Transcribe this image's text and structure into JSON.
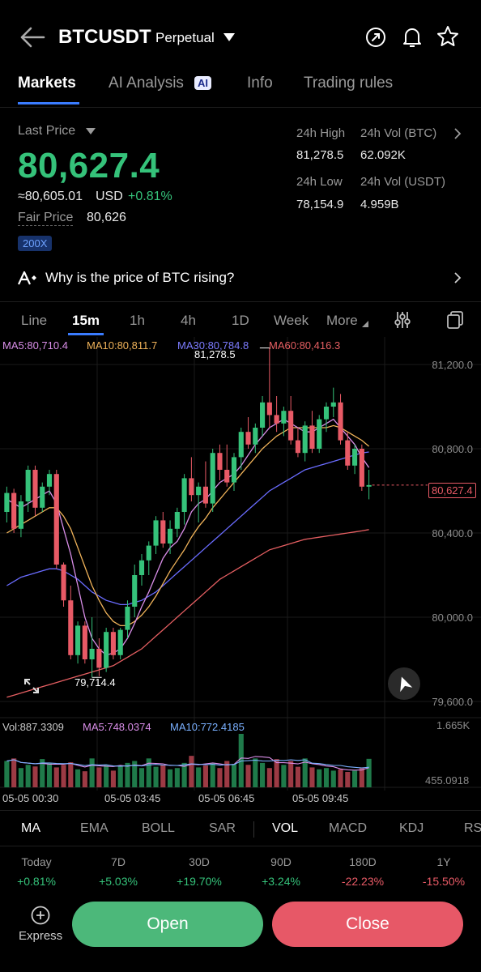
{
  "header": {
    "symbol": "BTCUSDT",
    "contract_type": "Perpetual",
    "icons": [
      "back-arrow-icon",
      "share-refresh-icon",
      "bell-icon",
      "star-icon"
    ]
  },
  "tabs": [
    {
      "label": "Markets",
      "active": true
    },
    {
      "label": "AI Analysis",
      "badge": "AI"
    },
    {
      "label": "Info"
    },
    {
      "label": "Trading rules"
    }
  ],
  "price": {
    "last_price_label": "Last Price",
    "last_price": "80,627.4",
    "approx_usd": "≈80,605.01",
    "usd_label": "USD",
    "change_pct": "+0.81%",
    "fair_price_label": "Fair Price",
    "fair_price": "80,626",
    "leverage_badge": "200X"
  },
  "stats": {
    "high_label": "24h High",
    "high": "81,278.5",
    "vol_btc_label": "24h Vol (BTC)",
    "vol_btc": "62.092K",
    "low_label": "24h Low",
    "low": "78,154.9",
    "vol_usdt_label": "24h Vol  (USDT)",
    "vol_usdt": "4.959B"
  },
  "insight": {
    "text": "Why is the price of BTC rising?"
  },
  "timeframes": [
    "Line",
    "15m",
    "1h",
    "4h",
    "1D",
    "Week",
    "More"
  ],
  "active_timeframe": "15m",
  "chart_data": {
    "type": "candlestick",
    "ma_legend": {
      "ma5": "MA5:80,710.4",
      "ma10": "MA10:80,811.7",
      "ma30": "MA30:80,784.8",
      "ma60": "MA60:80,416.3"
    },
    "y_ticks": [
      "81,200.0",
      "80,800.0",
      "80,400.0",
      "80,000.0",
      "79,600.0"
    ],
    "y_tick_values": [
      81200,
      80800,
      80400,
      80000,
      79600
    ],
    "high_marker": "81,278.5",
    "low_marker": "79,714.4",
    "current_price_tag": "80,627.4",
    "current_price": 80627.4,
    "x_ticks": [
      "05-05 00:30",
      "05-05 03:45",
      "05-05 06:45",
      "05-05 09:45"
    ],
    "candles": [
      [
        80500,
        80620,
        80450,
        80590
      ],
      [
        80590,
        80610,
        80400,
        80420
      ],
      [
        80420,
        80580,
        80380,
        80550
      ],
      [
        80550,
        80720,
        80500,
        80700
      ],
      [
        80700,
        80720,
        80480,
        80520
      ],
      [
        80520,
        80640,
        80500,
        80620
      ],
      [
        80620,
        80700,
        80580,
        80680
      ],
      [
        80680,
        80700,
        80230,
        80250
      ],
      [
        80250,
        80260,
        80050,
        80080
      ],
      [
        80080,
        80150,
        79800,
        79820
      ],
      [
        79820,
        79980,
        79780,
        79960
      ],
      [
        79960,
        79980,
        79780,
        79800
      ],
      [
        79800,
        80000,
        79714.4,
        79850
      ],
      [
        79850,
        79900,
        79720,
        79760
      ],
      [
        79760,
        79950,
        79740,
        79930
      ],
      [
        79930,
        79950,
        79800,
        79820
      ],
      [
        79820,
        79950,
        79800,
        79940
      ],
      [
        79940,
        80080,
        79900,
        80050
      ],
      [
        80050,
        80250,
        80000,
        80200
      ],
      [
        80200,
        80300,
        80150,
        80270
      ],
      [
        80270,
        80360,
        80200,
        80340
      ],
      [
        80340,
        80480,
        80300,
        80460
      ],
      [
        80460,
        80500,
        80330,
        80350
      ],
      [
        80350,
        80460,
        80300,
        80420
      ],
      [
        80420,
        80520,
        80380,
        80500
      ],
      [
        80500,
        80680,
        80440,
        80660
      ],
      [
        80660,
        80760,
        80550,
        80580
      ],
      [
        80580,
        80640,
        80450,
        80620
      ],
      [
        80620,
        80740,
        80520,
        80540
      ],
      [
        80540,
        80800,
        80500,
        80780
      ],
      [
        80780,
        80820,
        80650,
        80700
      ],
      [
        80700,
        80820,
        80620,
        80640
      ],
      [
        80640,
        80780,
        80600,
        80760
      ],
      [
        80760,
        80900,
        80700,
        80880
      ],
      [
        80880,
        80950,
        80800,
        80820
      ],
      [
        80820,
        80920,
        80780,
        80900
      ],
      [
        80900,
        81050,
        80860,
        81020
      ],
      [
        81020,
        81278.5,
        80900,
        80960
      ],
      [
        80960,
        81050,
        80880,
        80920
      ],
      [
        80920,
        81000,
        80860,
        80980
      ],
      [
        80980,
        81050,
        80820,
        80840
      ],
      [
        80840,
        80900,
        80760,
        80780
      ],
      [
        80780,
        80930,
        80740,
        80910
      ],
      [
        80910,
        80980,
        80780,
        80800
      ],
      [
        80800,
        80960,
        80780,
        80940
      ],
      [
        80940,
        81020,
        80880,
        81000
      ],
      [
        81000,
        81090,
        80950,
        81020
      ],
      [
        81020,
        81060,
        80820,
        80840
      ],
      [
        80840,
        80880,
        80700,
        80720
      ],
      [
        80720,
        80820,
        80680,
        80800
      ],
      [
        80800,
        80820,
        80600,
        80620
      ],
      [
        80620,
        80700,
        80560,
        80627.4
      ]
    ],
    "moving_averages": {
      "ma5": [
        80560,
        80540,
        80520,
        80540,
        80560,
        80580,
        80600,
        80540,
        80420,
        80300,
        80150,
        80000,
        79900,
        79850,
        79820,
        79830,
        79850,
        79900,
        79970,
        80050,
        80120,
        80200,
        80280,
        80330,
        80360,
        80420,
        80500,
        80540,
        80560,
        80600,
        80640,
        80660,
        80680,
        80720,
        80770,
        80820,
        80860,
        80900,
        80920,
        80940,
        80920,
        80900,
        80880,
        80880,
        80900,
        80920,
        80940,
        80900,
        80860,
        80820,
        80760,
        80710.4
      ],
      "ma10": [
        80400,
        80420,
        80440,
        80460,
        80480,
        80500,
        80520,
        80520,
        80480,
        80420,
        80330,
        80240,
        80150,
        80080,
        80020,
        79980,
        79960,
        79960,
        79980,
        80010,
        80050,
        80100,
        80160,
        80220,
        80270,
        80320,
        80380,
        80430,
        80470,
        80520,
        80560,
        80600,
        80640,
        80680,
        80720,
        80760,
        80800,
        80830,
        80860,
        80880,
        80900,
        80900,
        80900,
        80900,
        80900,
        80900,
        80910,
        80900,
        80880,
        80860,
        80840,
        80811.7
      ],
      "ma30": [
        80150,
        80170,
        80190,
        80200,
        80210,
        80220,
        80230,
        80230,
        80220,
        80200,
        80180,
        80150,
        80120,
        80100,
        80080,
        80070,
        80060,
        80060,
        80070,
        80080,
        80100,
        80120,
        80150,
        80180,
        80210,
        80240,
        80270,
        80300,
        80330,
        80360,
        80390,
        80420,
        80450,
        80480,
        80510,
        80540,
        80570,
        80600,
        80620,
        80640,
        80660,
        80680,
        80700,
        80710,
        80720,
        80730,
        80740,
        80750,
        80760,
        80770,
        80780,
        80784.8
      ],
      "ma60": [
        79620,
        79630,
        79640,
        79650,
        79660,
        79670,
        79680,
        79690,
        79700,
        79710,
        79720,
        79730,
        79740,
        79750,
        79760,
        79770,
        79790,
        79810,
        79830,
        79850,
        79880,
        79910,
        79940,
        79970,
        80000,
        80030,
        80060,
        80090,
        80120,
        80150,
        80180,
        80200,
        80220,
        80240,
        80260,
        80280,
        80300,
        80320,
        80330,
        80340,
        80350,
        80360,
        80370,
        80375,
        80380,
        80385,
        80390,
        80395,
        80400,
        80405,
        80410,
        80416.3
      ]
    },
    "volume": {
      "vol_label": "Vol:887.3309",
      "ma5_label": "MA5:748.0374",
      "ma10_label": "MA10:772.4185",
      "y_max": "1.665K",
      "y_min": "455.0918",
      "bars": [
        820,
        900,
        600,
        700,
        650,
        880,
        760,
        620,
        700,
        780,
        560,
        500,
        900,
        620,
        700,
        520,
        680,
        760,
        820,
        600,
        900,
        640,
        700,
        560,
        600,
        760,
        980,
        620,
        680,
        760,
        600,
        820,
        720,
        1665,
        700,
        900,
        760,
        600,
        880,
        700,
        820,
        640,
        900,
        620,
        560,
        600,
        520,
        560,
        480,
        520,
        620,
        887
      ]
    }
  },
  "indicators": [
    "MA",
    "EMA",
    "BOLL",
    "SAR",
    "VOL",
    "MACD",
    "KDJ",
    "RSI"
  ],
  "active_indicators": [
    "MA",
    "VOL"
  ],
  "periods": [
    {
      "label": "Today",
      "value": "+0.81%",
      "dir": "up"
    },
    {
      "label": "7D",
      "value": "+5.03%",
      "dir": "up"
    },
    {
      "label": "30D",
      "value": "+19.70%",
      "dir": "up"
    },
    {
      "label": "90D",
      "value": "+3.24%",
      "dir": "up"
    },
    {
      "label": "180D",
      "value": "-22.23%",
      "dir": "down"
    },
    {
      "label": "1Y",
      "value": "-15.50%",
      "dir": "down"
    }
  ],
  "bottom": {
    "express_label": "Express",
    "open_label": "Open",
    "close_label": "Close"
  },
  "colors": {
    "up": "#35c27a",
    "down": "#e85a66",
    "ma5": "#d98ee8",
    "ma10": "#f0b35a",
    "ma30": "#6a6cff",
    "ma60": "#e65f62"
  }
}
